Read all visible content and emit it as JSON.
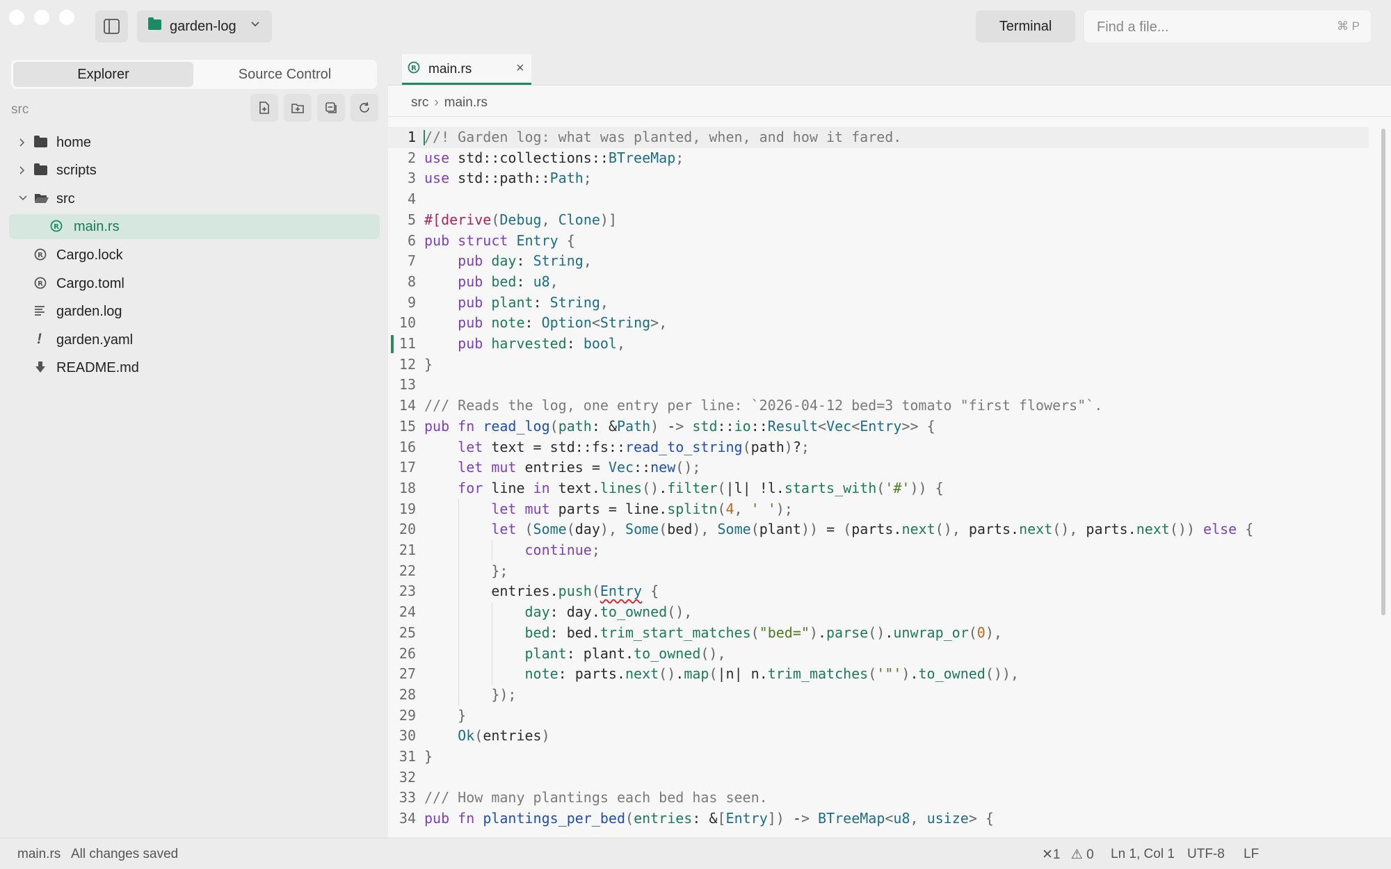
{
  "window": {
    "project_name": "garden-log",
    "terminal_label": "Terminal",
    "search_placeholder": "Find a file...",
    "search_shortcut": "⌘ P",
    "colors": {
      "accent": "#1c8a64",
      "selection": "#d5e7df",
      "error": "#d03030"
    }
  },
  "sidebar": {
    "tabs": [
      "Explorer",
      "Source Control"
    ],
    "active_tab": "Explorer",
    "root_label": "src",
    "toolbar_icons": [
      "new-file-icon",
      "new-folder-icon",
      "collapse-all-icon",
      "refresh-icon"
    ],
    "items": [
      {
        "label": "home",
        "kind": "folder",
        "expanded": false,
        "depth": 0
      },
      {
        "label": "scripts",
        "kind": "folder",
        "expanded": false,
        "depth": 0
      },
      {
        "label": "src",
        "kind": "folder",
        "expanded": true,
        "depth": 0
      },
      {
        "label": "main.rs",
        "kind": "rust",
        "depth": 1,
        "selected": true
      },
      {
        "label": "Cargo.lock",
        "kind": "rust",
        "depth": 0
      },
      {
        "label": "Cargo.toml",
        "kind": "rust",
        "depth": 0
      },
      {
        "label": "garden.log",
        "kind": "text",
        "depth": 0
      },
      {
        "label": "garden.yaml",
        "kind": "yaml",
        "depth": 0
      },
      {
        "label": "README.md",
        "kind": "markdown",
        "depth": 0
      }
    ]
  },
  "editor": {
    "tab_label": "main.rs",
    "tab_close": "×",
    "breadcrumb": [
      "src",
      "main.rs"
    ],
    "modified_line": 11,
    "current_line": 1,
    "lines": [
      "//! Garden log: what was planted, when, and how it fared.",
      "use std::collections::BTreeMap;",
      "use std::path::Path;",
      "",
      "#[derive(Debug, Clone)]",
      "pub struct Entry {",
      "    pub day: String,",
      "    pub bed: u8,",
      "    pub plant: String,",
      "    pub note: Option<String>,",
      "    pub harvested: bool,",
      "}",
      "",
      "/// Reads the log, one entry per line: `2026-04-12 bed=3 tomato \"first flowers\"`.",
      "pub fn read_log(path: &Path) -> std::io::Result<Vec<Entry>> {",
      "    let text = std::fs::read_to_string(path)?;",
      "    let mut entries = Vec::new();",
      "    for line in text.lines().filter(|l| !l.starts_with('#')) {",
      "        let mut parts = line.splitn(4, ' ');",
      "        let (Some(day), Some(bed), Some(plant)) = (parts.next(), parts.next(), parts.next()) else {",
      "            continue;",
      "        };",
      "        entries.push(Entry {",
      "            day: day.to_owned(),",
      "            bed: bed.trim_start_matches(\"bed=\").parse().unwrap_or(0),",
      "            plant: plant.to_owned(),",
      "            note: parts.next().map(|n| n.trim_matches('\"').to_owned()),",
      "        });",
      "    }",
      "    Ok(entries)",
      "}",
      "",
      "/// How many plantings each bed has seen.",
      "pub fn plantings_per_bed(entries: &[Entry]) -> BTreeMap<u8, usize> {"
    ]
  },
  "status": {
    "file": "main.rs",
    "save_state": "All changes saved",
    "errors": "1",
    "warnings": "0",
    "cursor": "Ln 1, Col 1",
    "encoding": "UTF-8",
    "line_ending": "LF"
  }
}
